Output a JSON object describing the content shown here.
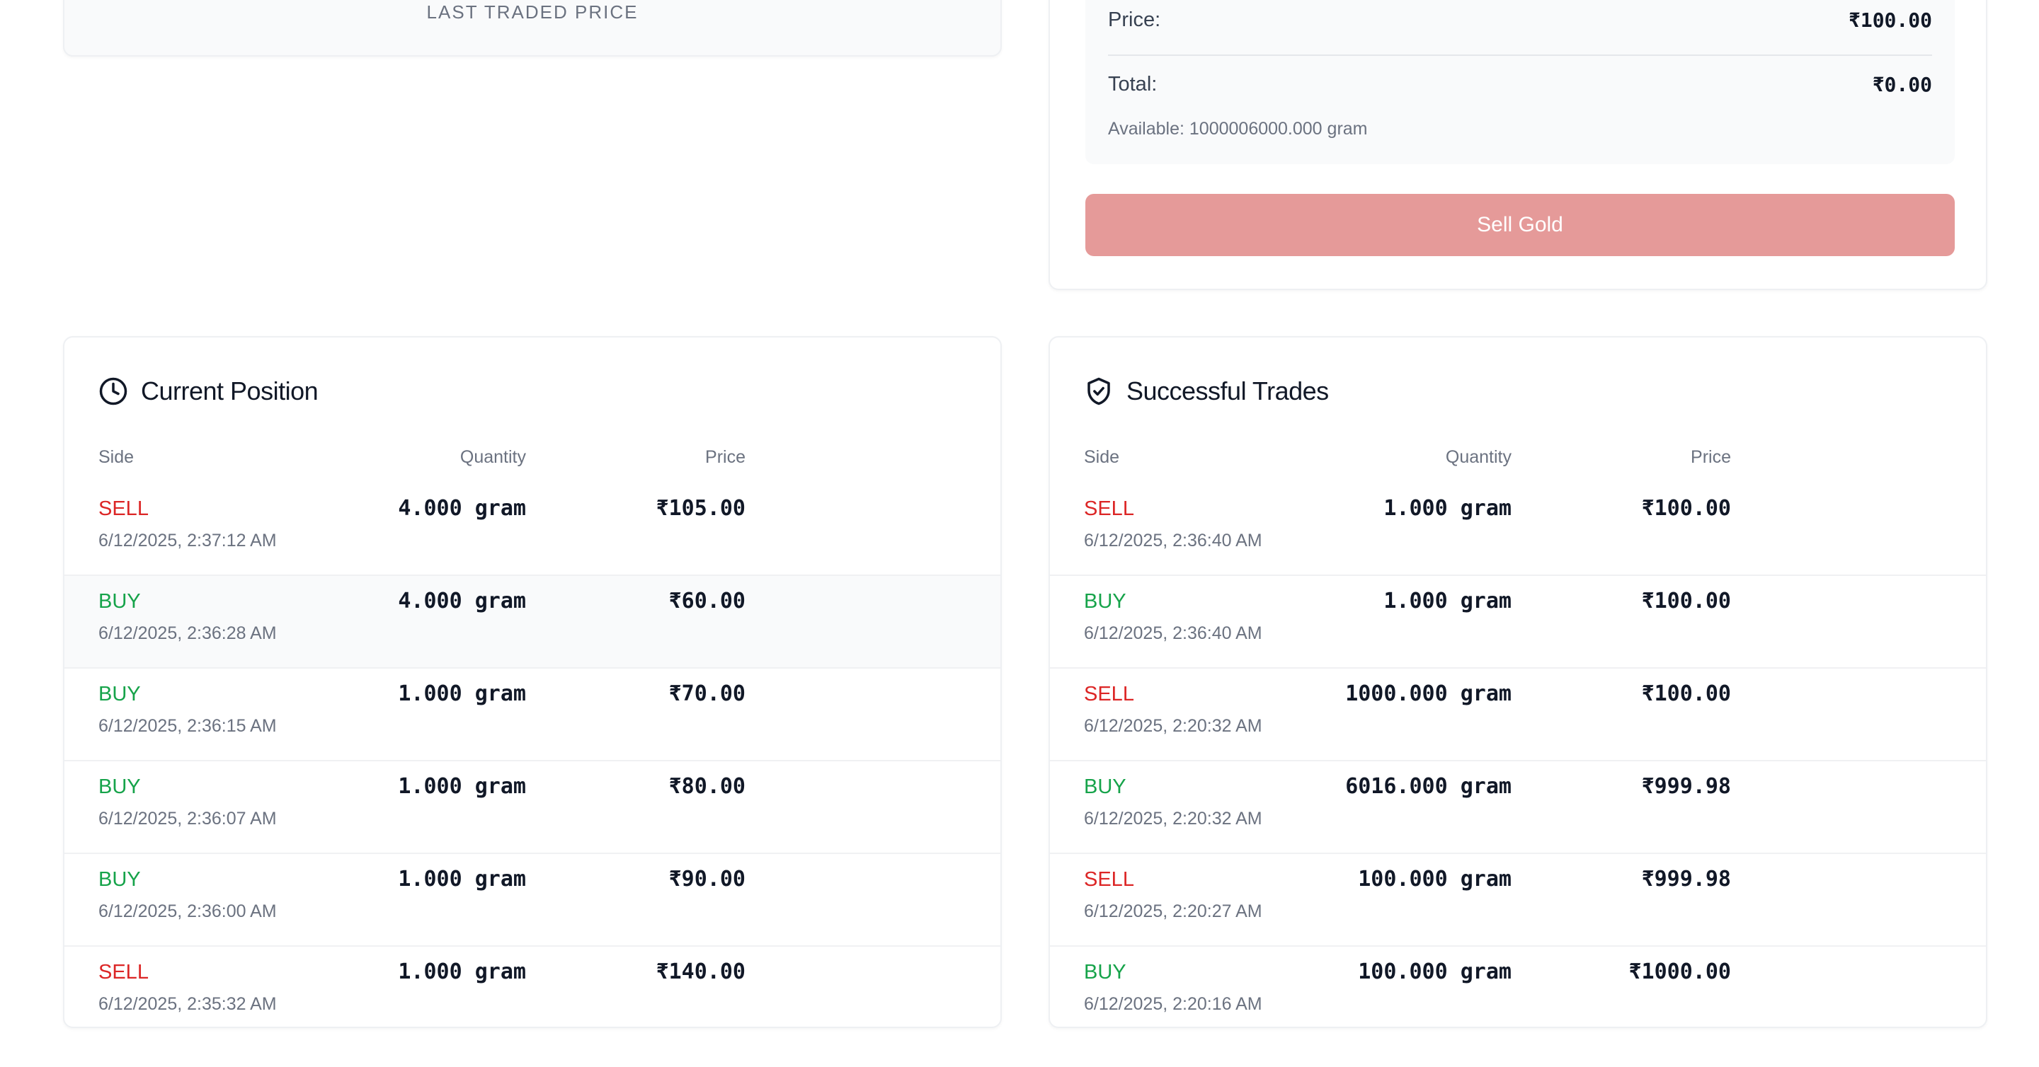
{
  "ltp": {
    "label": "LAST TRADED PRICE"
  },
  "sell": {
    "price_label": "Price:",
    "price_value": "₹100.00",
    "total_label": "Total:",
    "total_value": "₹0.00",
    "available": "Available: 1000006000.000 gram",
    "button_label": "Sell Gold",
    "button_color": "#e59a99"
  },
  "columns": {
    "side": "Side",
    "quantity": "Quantity",
    "price": "Price"
  },
  "position": {
    "title": "Current Position",
    "icon": "clock-icon",
    "rows": [
      {
        "side": "SELL",
        "time": "6/12/2025, 2:37:12 AM",
        "qty": "4.000 gram",
        "price": "₹105.00"
      },
      {
        "side": "BUY",
        "time": "6/12/2025, 2:36:28 AM",
        "qty": "4.000 gram",
        "price": "₹60.00"
      },
      {
        "side": "BUY",
        "time": "6/12/2025, 2:36:15 AM",
        "qty": "1.000 gram",
        "price": "₹70.00"
      },
      {
        "side": "BUY",
        "time": "6/12/2025, 2:36:07 AM",
        "qty": "1.000 gram",
        "price": "₹80.00"
      },
      {
        "side": "BUY",
        "time": "6/12/2025, 2:36:00 AM",
        "qty": "1.000 gram",
        "price": "₹90.00"
      },
      {
        "side": "SELL",
        "time": "6/12/2025, 2:35:32 AM",
        "qty": "1.000 gram",
        "price": "₹140.00"
      }
    ]
  },
  "trades": {
    "title": "Successful Trades",
    "icon": "shield-check-icon",
    "rows": [
      {
        "side": "SELL",
        "time": "6/12/2025, 2:36:40 AM",
        "qty": "1.000 gram",
        "price": "₹100.00"
      },
      {
        "side": "BUY",
        "time": "6/12/2025, 2:36:40 AM",
        "qty": "1.000 gram",
        "price": "₹100.00"
      },
      {
        "side": "SELL",
        "time": "6/12/2025, 2:20:32 AM",
        "qty": "1000.000 gram",
        "price": "₹100.00"
      },
      {
        "side": "BUY",
        "time": "6/12/2025, 2:20:32 AM",
        "qty": "6016.000 gram",
        "price": "₹999.98"
      },
      {
        "side": "SELL",
        "time": "6/12/2025, 2:20:27 AM",
        "qty": "100.000 gram",
        "price": "₹999.98"
      },
      {
        "side": "BUY",
        "time": "6/12/2025, 2:20:16 AM",
        "qty": "100.000 gram",
        "price": "₹1000.00"
      }
    ]
  },
  "colors": {
    "sell": "#dc2626",
    "buy": "#16a34a"
  }
}
